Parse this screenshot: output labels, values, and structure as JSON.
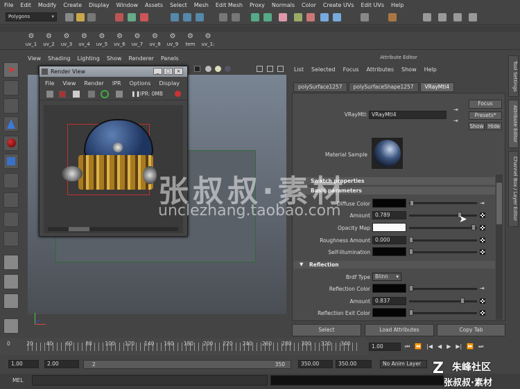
{
  "menubar": [
    "File",
    "Edit",
    "Modify",
    "Create",
    "Display",
    "Window",
    "Assets",
    "Select",
    "Mesh",
    "Edit Mesh",
    "Proxy",
    "Normals",
    "Color",
    "Create UVs",
    "Edit UVs",
    "Help"
  ],
  "mode_dropdown": "Polygons",
  "shelf_items": [
    "uv_1",
    "uv_2",
    "uv_3",
    "uv_4",
    "uv_5",
    "uv_6",
    "uv_7",
    "uv_8",
    "uv_9",
    "tem",
    "uv_1:"
  ],
  "viewport_menu": [
    "View",
    "Shading",
    "Lighting",
    "Show",
    "Renderer",
    "Panels"
  ],
  "render_view": {
    "title": "Render View",
    "menu": [
      "File",
      "View",
      "Render",
      "IPR",
      "Options",
      "Display"
    ],
    "ipr_label": "IPR: 0MB",
    "min_btn": "_",
    "max_btn": "□",
    "close_btn": "×"
  },
  "attribute_editor": {
    "header": "Attribute Editor",
    "menu": [
      "List",
      "Selected",
      "Focus",
      "Attributes",
      "Show",
      "Help"
    ],
    "tabs": [
      "polySurface1257",
      "polySurfaceShape1257",
      "VRayMtl4"
    ],
    "active_tab": "VRayMtl4",
    "mtl_label": "VRayMtl:",
    "mtl_name": "VRayMtl4",
    "focus_btn": "Focus",
    "presets_btn": "Presets*",
    "show_btn": "Show",
    "hide_btn": "Hide",
    "material_sample_label": "Material Sample",
    "sections": {
      "swatch": "Swatch properties",
      "basic": "Basic parameters",
      "reflection": "Reflection"
    },
    "attrs": {
      "diffuse_color": "Diffuse Color",
      "amount": "Amount",
      "amount_value": "0.789",
      "opacity_map": "Opacity Map",
      "roughness_amount": "Roughness Amount",
      "roughness_value": "0.000",
      "self_illumination": "Self-Illumination",
      "brdf_type": "Brdf Type",
      "brdf_value": "Blinn",
      "reflection_color": "Reflection Color",
      "refl_amount": "Amount",
      "refl_amount_value": "0.837",
      "reflection_exit_color": "Reflection Exit Color"
    },
    "bottom_buttons": [
      "Select",
      "Load Attributes",
      "Copy Tab"
    ]
  },
  "side_tabs": [
    "Tool Settings",
    "Attribute Editor",
    "Channel Box / Layer Editor"
  ],
  "timeline": {
    "ticks": [
      "0",
      "20",
      "40",
      "60",
      "80",
      "100",
      "120",
      "140",
      "160",
      "180",
      "200",
      "220",
      "240",
      "260",
      "280",
      "300",
      "320",
      "340"
    ],
    "current_frame": "1.00"
  },
  "range": {
    "start": "1.00",
    "playback_start": "2.00",
    "slider_start": "2",
    "slider_end": "350",
    "playback_end": "350.00",
    "end": "350.00",
    "anim_layer": "No Anim Layer"
  },
  "cmd_label": "MEL",
  "watermark": {
    "cn_main": "张叔叔·素材",
    "url": "unclezhang.taobao.com",
    "corner_top": "朱峰社区",
    "corner_bottom": "张叔叔·素材"
  },
  "colors": {
    "accent_red": "#c03030",
    "plane_border": "#2e6a3c"
  }
}
